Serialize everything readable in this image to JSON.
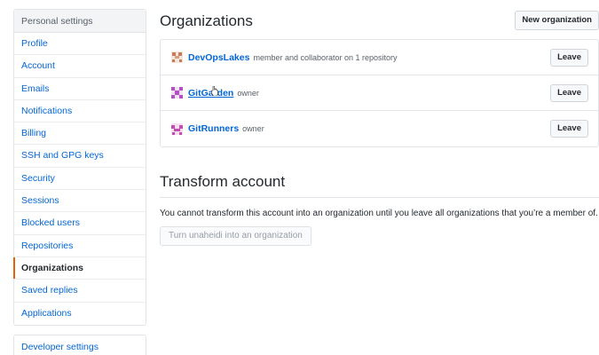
{
  "sidebar": {
    "header": "Personal settings",
    "items": [
      {
        "label": "Profile"
      },
      {
        "label": "Account"
      },
      {
        "label": "Emails"
      },
      {
        "label": "Notifications"
      },
      {
        "label": "Billing"
      },
      {
        "label": "SSH and GPG keys"
      },
      {
        "label": "Security"
      },
      {
        "label": "Sessions"
      },
      {
        "label": "Blocked users"
      },
      {
        "label": "Repositories"
      },
      {
        "label": "Organizations",
        "selected": true
      },
      {
        "label": "Saved replies"
      },
      {
        "label": "Applications"
      }
    ],
    "developer_settings": "Developer settings"
  },
  "organizations": {
    "title": "Organizations",
    "new_button": "New organization",
    "items": [
      {
        "name": "DevOpsLakes",
        "role": "member and collaborator on 1 repository",
        "leave_label": "Leave",
        "avatar_color": "#c97a5a"
      },
      {
        "name": "GitGarden",
        "role": "owner",
        "leave_label": "Leave",
        "avatar_color": "#b44fc7"
      },
      {
        "name": "GitRunners",
        "role": "owner",
        "leave_label": "Leave",
        "avatar_color": "#c44bb0"
      }
    ]
  },
  "transform": {
    "title": "Transform account",
    "description": "You cannot transform this account into an organization until you leave all organizations that you’re a member of.",
    "button": "Turn unaheidi into an organization"
  },
  "colors": {
    "link": "#0366d6",
    "selected_indicator": "#e36209"
  }
}
